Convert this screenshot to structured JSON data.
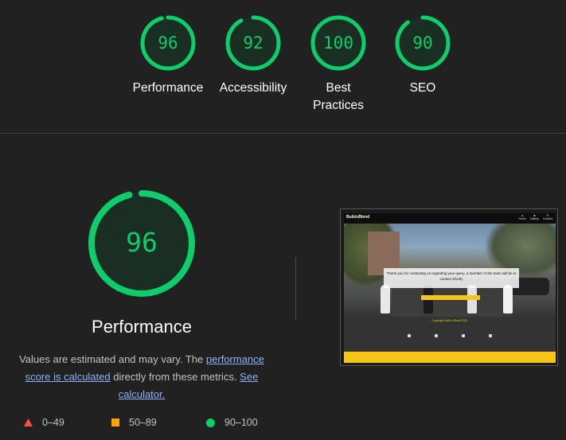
{
  "categories": [
    {
      "score": "96",
      "label": "Performance",
      "value": 0.96
    },
    {
      "score": "92",
      "label": "Accessibility",
      "value": 0.92
    },
    {
      "score": "100",
      "label_line1": "Best",
      "label_line2": "Practices",
      "value": 1.0
    },
    {
      "score": "90",
      "label": "SEO",
      "value": 0.9
    }
  ],
  "main": {
    "score": "96",
    "value": 0.96,
    "title": "Performance",
    "desc_prefix": "Values are estimated and may vary. The ",
    "desc_link1": "performance score is calculated",
    "desc_middle": " directly from these metrics. ",
    "desc_link2": "See calculator.",
    "pass_color": "#0cce6b",
    "pass_fill": "#1b2e24"
  },
  "legend": {
    "fail": "0–49",
    "average": "50–89",
    "pass": "90–100",
    "fail_color": "#ff4e42",
    "average_color": "#ffa400",
    "pass_color": "#0cce6b"
  },
  "thumbnail": {
    "logo_a": "Build",
    "logo_b": "a",
    "logo_c": "Blend",
    "nav": [
      "Home",
      "Gallery",
      "Contact"
    ],
    "message": "Thank you for contacting us regarding your query, a member of the team will be in contact shortly",
    "footer_text": "Copyright Build a Blend 2021"
  }
}
